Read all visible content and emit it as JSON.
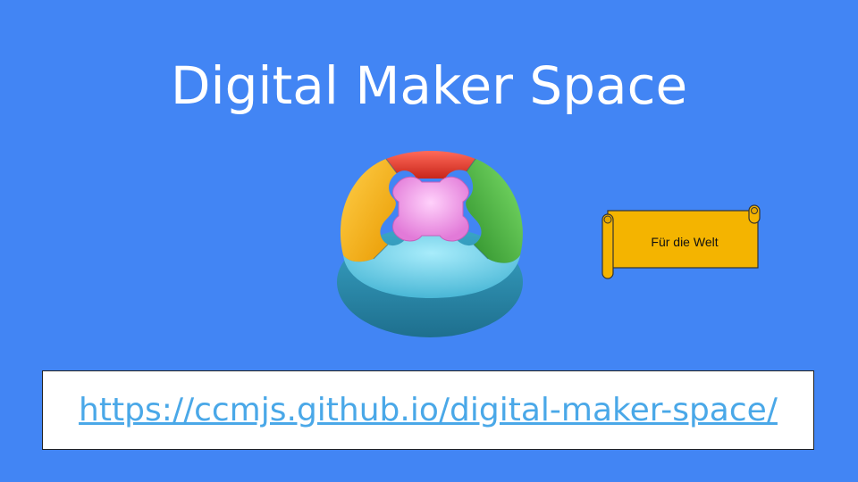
{
  "slide": {
    "title": "Digital Maker Space",
    "scroll_label": "Für die Welt",
    "url": "https://ccmjs.github.io/digital-maker-space/"
  },
  "logo": {
    "icon": "puzzle-circle-icon",
    "colors": {
      "yellow": "#f4b400",
      "red": "#ea4335",
      "green": "#34a853",
      "blue": "#5cc6e0",
      "pink": "#f3a0ee"
    }
  },
  "colors": {
    "background": "#4285f4",
    "scroll": "#f4b400",
    "link": "#4aa8e8"
  }
}
